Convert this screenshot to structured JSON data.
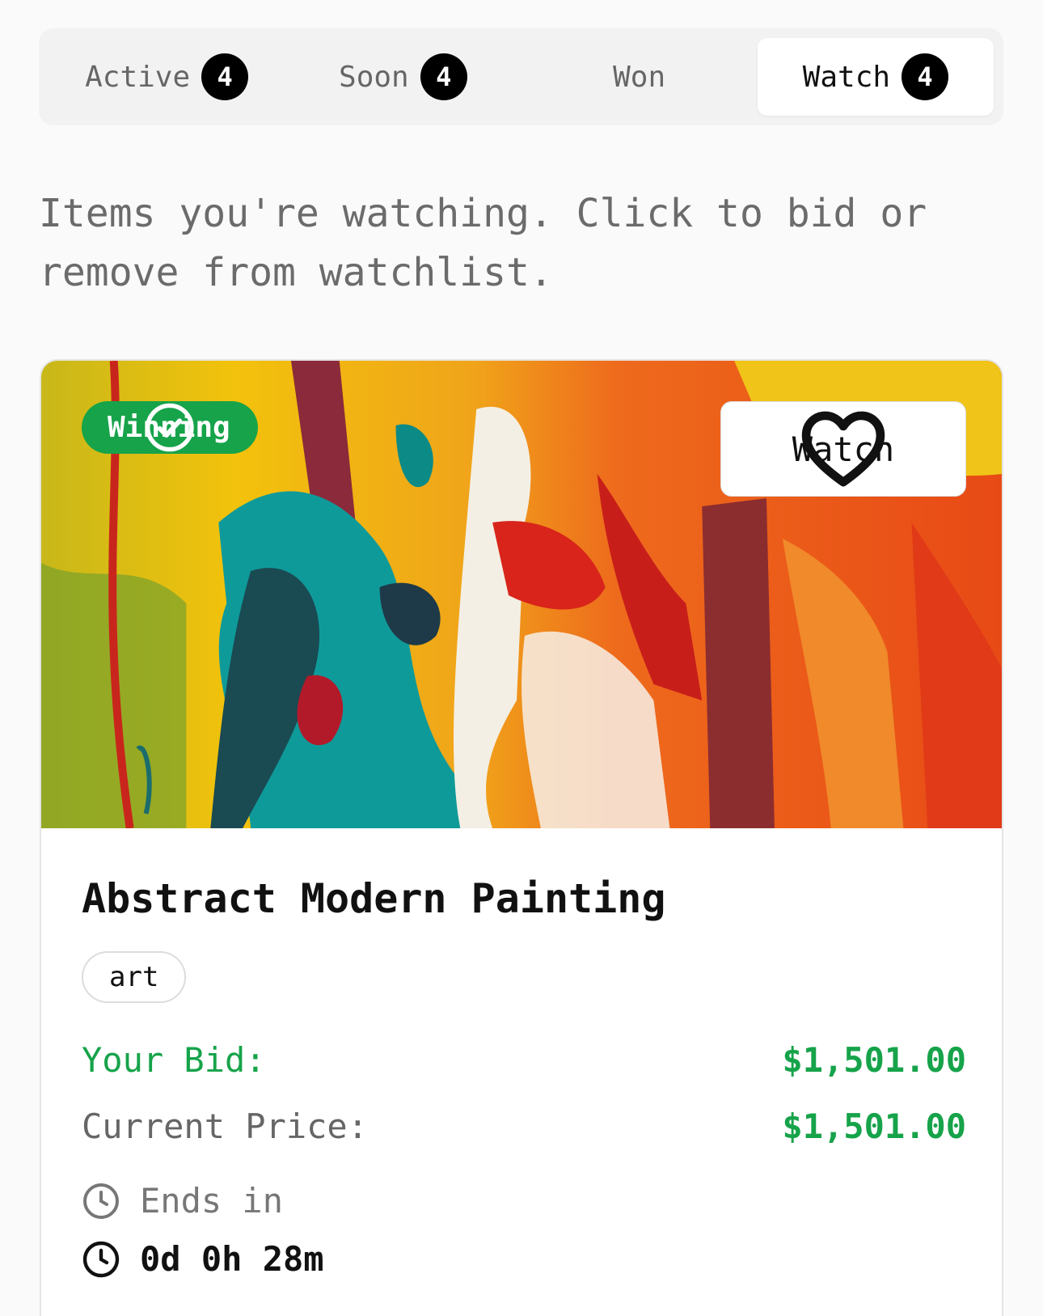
{
  "tabs": [
    {
      "label": "Active",
      "count": "4"
    },
    {
      "label": "Soon",
      "count": "4"
    },
    {
      "label": "Won"
    },
    {
      "label": "Watch",
      "count": "4",
      "selected": true
    }
  ],
  "intro": "Items you're watching. Click to bid or remove from watchlist.",
  "item": {
    "status": "Winning",
    "status_icon": "check-circle-icon",
    "watch_label": "Watch",
    "watch_icon": "heart-icon",
    "title": "Abstract Modern Painting",
    "tag": "art",
    "your_bid_label": "Your Bid:",
    "your_bid_value": "$1,501.00",
    "current_price_label": "Current Price:",
    "current_price_value": "$1,501.00",
    "ends_label": "Ends in",
    "time_remaining": "0d 0h 28m"
  },
  "colors": {
    "accent_green": "#16a34a",
    "badge": "#000000"
  }
}
